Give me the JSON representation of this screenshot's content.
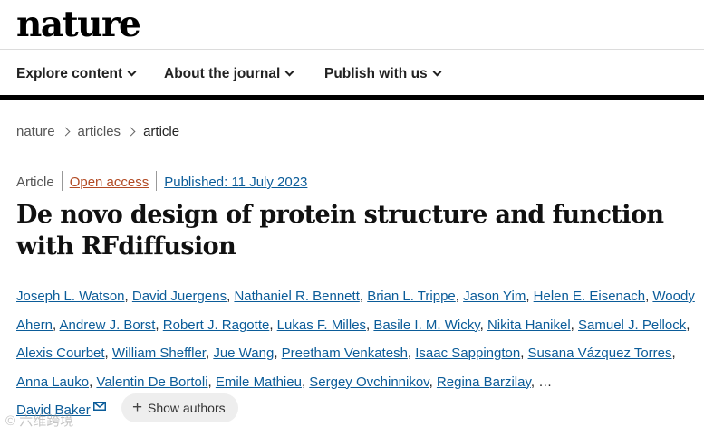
{
  "logo": {
    "text": "nature"
  },
  "nav": {
    "items": [
      {
        "label": "Explore content"
      },
      {
        "label": "About the journal"
      },
      {
        "label": "Publish with us"
      }
    ]
  },
  "breadcrumb": {
    "items": [
      "nature",
      "articles"
    ],
    "current": "article"
  },
  "article": {
    "type": "Article",
    "access": "Open access",
    "published": "Published: 11 July 2023",
    "title": "De novo design of protein structure and function with RFdiffusion",
    "authors": [
      "Joseph L. Watson",
      "David Juergens",
      "Nathaniel R. Bennett",
      "Brian L. Trippe",
      "Jason Yim",
      "Helen E. Eisenach",
      "Woody Ahern",
      "Andrew J. Borst",
      "Robert J. Ragotte",
      "Lukas F. Milles",
      "Basile I. M. Wicky",
      "Nikita Hanikel",
      "Samuel J. Pellock",
      "Alexis Courbet",
      "William Sheffler",
      "Jue Wang",
      "Preetham Venkatesh",
      "Isaac Sappington",
      "Susana Vázquez Torres",
      "Anna Lauko",
      "Valentin De Bortoli",
      "Emile Mathieu",
      "Sergey Ovchinnikov",
      "Regina Barzilay"
    ],
    "ellipsis": "…",
    "last_author": "David Baker",
    "show_authors_label": "Show authors"
  },
  "icons": {
    "mail": "mail-icon",
    "plus": "plus-icon",
    "chevron": "chevron-down-icon"
  },
  "watermark": "© 六维跨境",
  "colors": {
    "link": "#0b5c99",
    "open_access": "#b24a23",
    "nav_border": "#000000"
  }
}
